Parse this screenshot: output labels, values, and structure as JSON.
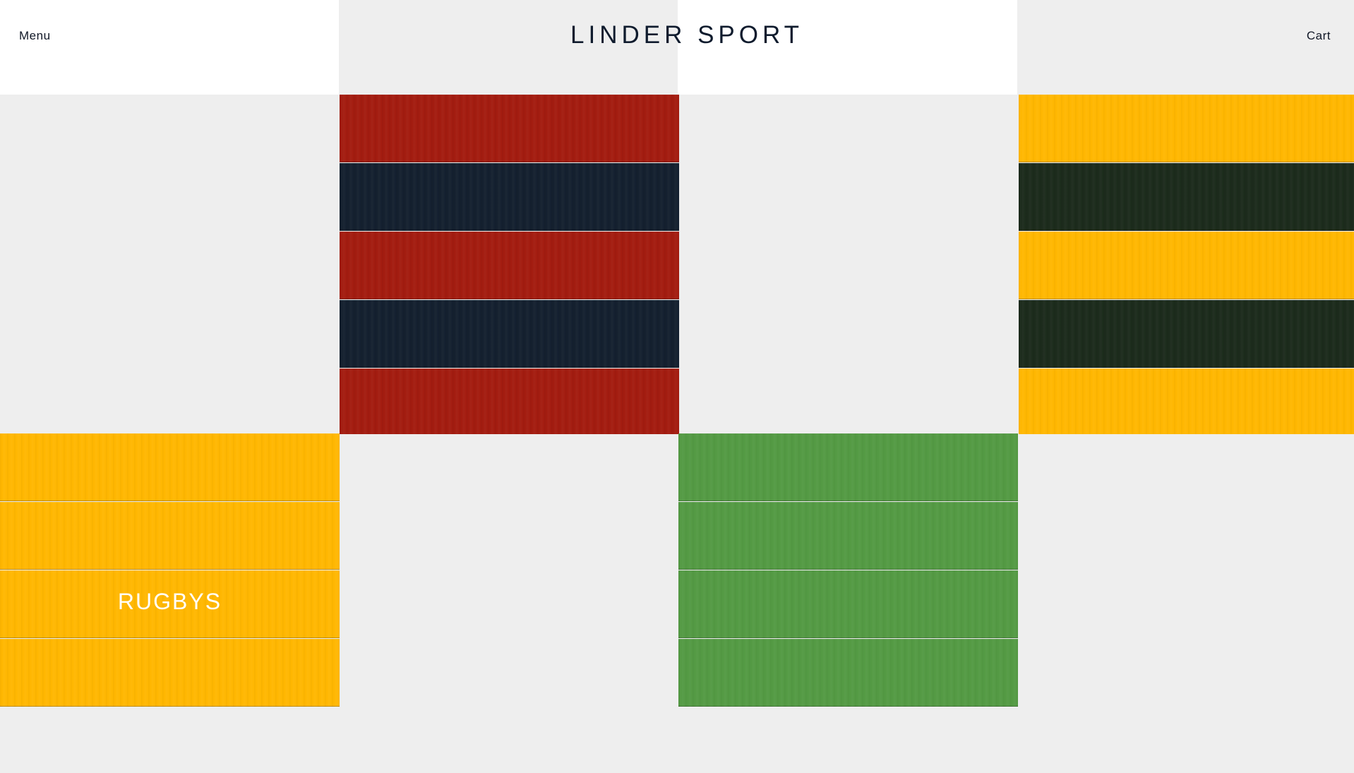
{
  "header": {
    "menu_label": "Menu",
    "logo_text": "LINDER SPORT",
    "cart_label": "Cart"
  },
  "tiles": [
    {
      "name": "red-navy-stripes",
      "label": "",
      "colors": [
        "#a31c10",
        "#14202f"
      ]
    },
    {
      "name": "yellow-darkgreen-stripes",
      "label": "",
      "colors": [
        "#ffb701",
        "#1c2b1c"
      ]
    },
    {
      "name": "yellow-planks",
      "label": "RUGBYS",
      "colors": [
        "#ffb701"
      ]
    },
    {
      "name": "green-planks",
      "label": "",
      "colors": [
        "#549a44"
      ]
    }
  ],
  "colors": {
    "background": "#eeeeee",
    "header_white": "#ffffff",
    "text": "#111827",
    "logo": "#0f1b2d"
  }
}
